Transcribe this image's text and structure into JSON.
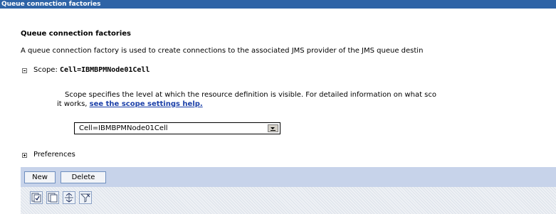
{
  "titlebar": {
    "text": "Queue connection factories"
  },
  "page": {
    "heading": "Queue connection factories",
    "description": "A queue connection factory is used to create connections to the associated JMS provider of the JMS queue destin"
  },
  "scope": {
    "label_prefix": "Scope: ",
    "value": "Cell=IBMBPMNode01Cell",
    "help_line1": "Scope specifies the level at which the resource definition is visible. For detailed information on what sco",
    "help_line2_prefix": "it works, ",
    "help_link": "see the scope settings help.",
    "select_value": "Cell=IBMBPMNode01Cell"
  },
  "preferences": {
    "label": "Preferences"
  },
  "toolbar": {
    "new_label": "New",
    "delete_label": "Delete"
  },
  "icons": [
    "select-all-icon",
    "deselect-all-icon",
    "add-column-icon",
    "filter-icon"
  ],
  "colors": {
    "titlebar": "#2e63a6",
    "button_bar": "#c7d3ea",
    "link": "#1a3fa8"
  }
}
